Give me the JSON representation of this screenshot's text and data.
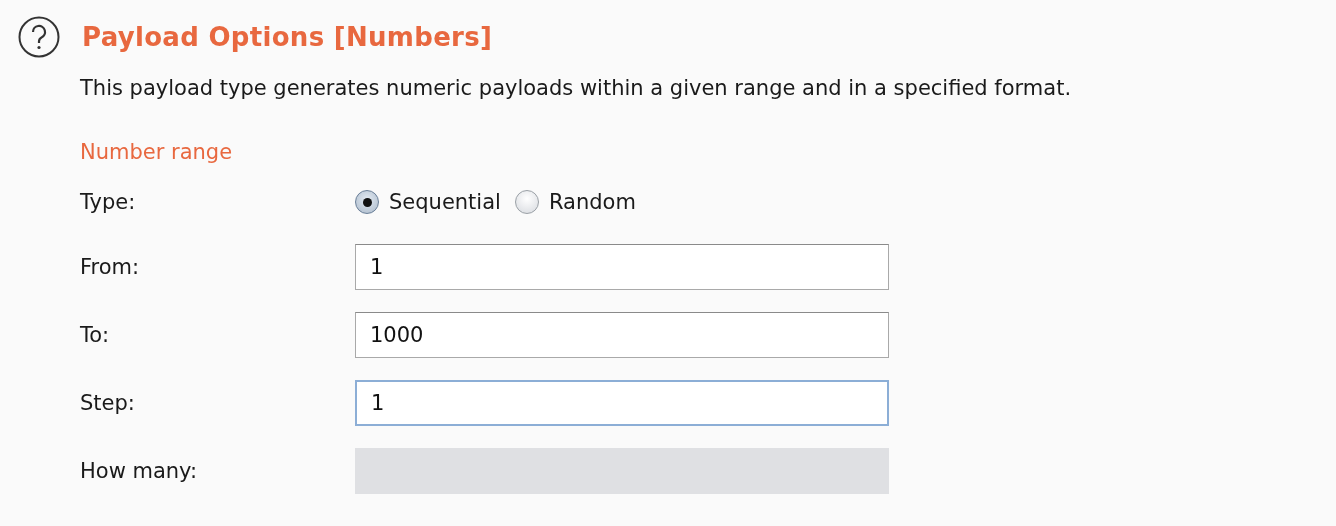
{
  "section": {
    "title": "Payload Options [Numbers]",
    "description": "This payload type generates numeric payloads within a given range and in a specified format."
  },
  "group": {
    "title": "Number range",
    "type_row": {
      "label": "Type:",
      "options": [
        {
          "label": "Sequential",
          "selected": true
        },
        {
          "label": "Random",
          "selected": false
        }
      ]
    },
    "fields": [
      {
        "label": "From:",
        "value": "1",
        "focused": false,
        "disabled": false
      },
      {
        "label": "To:",
        "value": "1000",
        "focused": false,
        "disabled": false
      },
      {
        "label": "Step:",
        "value": "1",
        "focused": true,
        "disabled": false
      },
      {
        "label": "How many:",
        "focused": false,
        "disabled": true
      }
    ]
  }
}
